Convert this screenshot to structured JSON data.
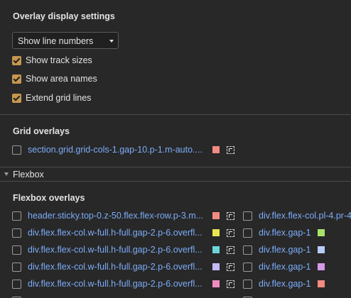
{
  "overlay_settings": {
    "heading": "Overlay display settings",
    "select_value": "Show line numbers",
    "checkboxes": [
      {
        "label": "Show track sizes",
        "checked": true
      },
      {
        "label": "Show area names",
        "checked": true
      },
      {
        "label": "Extend grid lines",
        "checked": true
      }
    ]
  },
  "grid": {
    "heading": "Grid overlays",
    "items": [
      {
        "label": "section.grid.grid-cols-1.gap-10.p-1.m-auto....",
        "color": "#f28b82",
        "checked": false
      }
    ]
  },
  "flexbox": {
    "section_label": "Flexbox",
    "heading": "Flexbox overlays",
    "left_items": [
      {
        "label": "header.sticky.top-0.z-50.flex.flex-row.p-3.m...",
        "color": "#f28b82",
        "checked": false
      },
      {
        "label": "div.flex.flex-col.w-full.h-full.gap-2.p-6.overfl...",
        "color": "#e8e552",
        "checked": false
      },
      {
        "label": "div.flex.flex-col.w-full.h-full.gap-2.p-6.overfl...",
        "color": "#6bd5d8",
        "checked": false
      },
      {
        "label": "div.flex.flex-col.w-full.h-full.gap-2.p-6.overfl...",
        "color": "#c5b9f5",
        "checked": false
      },
      {
        "label": "div.flex.flex-col.w-full.h-full.gap-2.p-6.overfl...",
        "color": "#f08cc2",
        "checked": false
      }
    ],
    "right_items": [
      {
        "label": "div.flex.flex-col.pl-4.pr-4",
        "color": "",
        "checked": false
      },
      {
        "label": "div.flex.gap-1",
        "color": "#a8e26b",
        "checked": false
      },
      {
        "label": "div.flex.gap-1",
        "color": "#b8cdf5",
        "checked": false
      },
      {
        "label": "div.flex.gap-1",
        "color": "#d49ae8",
        "checked": false
      },
      {
        "label": "div.flex.gap-1",
        "color": "#f28b82",
        "checked": false
      }
    ]
  }
}
